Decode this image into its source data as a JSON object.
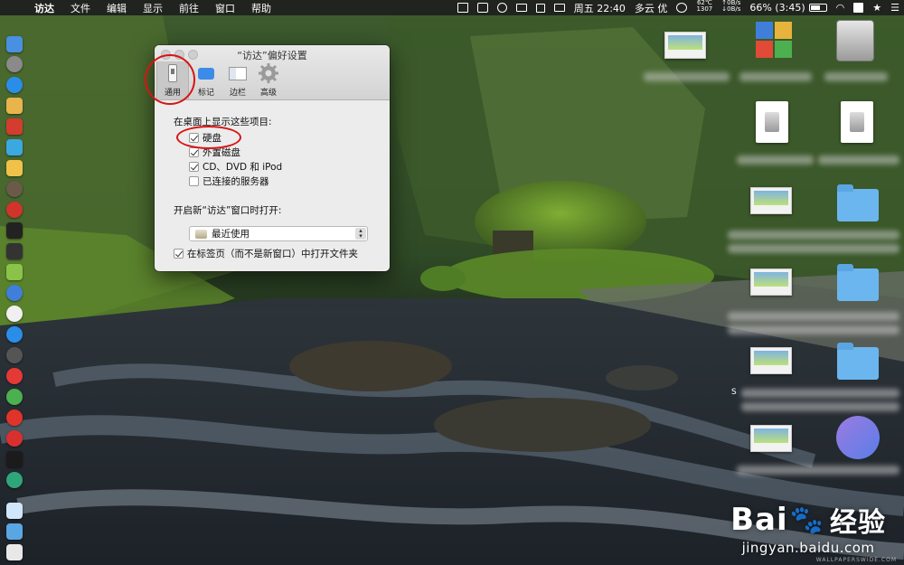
{
  "menubar": {
    "app_name": "访达",
    "menus": [
      "文件",
      "编辑",
      "显示",
      "前往",
      "窗口",
      "帮助"
    ],
    "weather_top": "62℃",
    "weather_bottom": "1307",
    "net_up": "↑0B/s",
    "net_down": "↓0B/s",
    "clock": "周五 22:40",
    "weather": "多云 优",
    "battery": "66% (3:45)"
  },
  "window": {
    "title": "“访达”偏好设置",
    "tabs": [
      {
        "label": "通用",
        "icon": "general-icon",
        "selected": true
      },
      {
        "label": "标记",
        "icon": "tags-icon",
        "selected": false
      },
      {
        "label": "边栏",
        "icon": "sidebar-icon",
        "selected": false
      },
      {
        "label": "高级",
        "icon": "gear-icon",
        "selected": false
      }
    ],
    "desktop_section_label": "在桌面上显示这些项目:",
    "desktop_items": [
      {
        "label": "硬盘",
        "checked": true
      },
      {
        "label": "外置磁盘",
        "checked": true
      },
      {
        "label": "CD、DVD 和 iPod",
        "checked": true
      },
      {
        "label": "已连接的服务器",
        "checked": false
      }
    ],
    "new_window_label": "开启新“访达”窗口时打开:",
    "new_window_value": "最近使用",
    "open_in_tabs": {
      "label": "在标签页（而不是新窗口）中打开文件夹",
      "checked": true
    }
  },
  "desktop": {
    "overlay_letter": "S"
  },
  "watermark": {
    "brand_left": "Bai",
    "brand_right": "经验",
    "url": "jingyan.baidu.com",
    "credit": "WALLPAPERSWIDE.COM"
  },
  "colors": {
    "annotation_red": "#d81414",
    "accent_blue": "#2e7cf6"
  }
}
